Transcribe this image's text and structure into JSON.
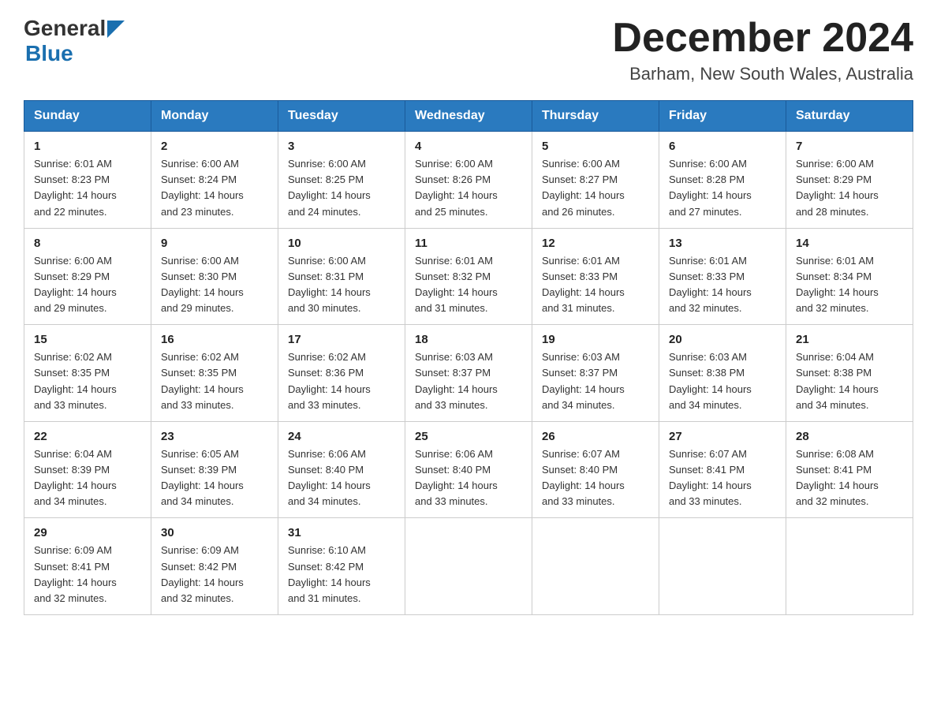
{
  "header": {
    "logo_general": "General",
    "logo_blue": "Blue",
    "month_year": "December 2024",
    "location": "Barham, New South Wales, Australia"
  },
  "weekdays": [
    "Sunday",
    "Monday",
    "Tuesday",
    "Wednesday",
    "Thursday",
    "Friday",
    "Saturday"
  ],
  "weeks": [
    [
      {
        "day": "1",
        "sunrise": "6:01 AM",
        "sunset": "8:23 PM",
        "daylight": "14 hours and 22 minutes."
      },
      {
        "day": "2",
        "sunrise": "6:00 AM",
        "sunset": "8:24 PM",
        "daylight": "14 hours and 23 minutes."
      },
      {
        "day": "3",
        "sunrise": "6:00 AM",
        "sunset": "8:25 PM",
        "daylight": "14 hours and 24 minutes."
      },
      {
        "day": "4",
        "sunrise": "6:00 AM",
        "sunset": "8:26 PM",
        "daylight": "14 hours and 25 minutes."
      },
      {
        "day": "5",
        "sunrise": "6:00 AM",
        "sunset": "8:27 PM",
        "daylight": "14 hours and 26 minutes."
      },
      {
        "day": "6",
        "sunrise": "6:00 AM",
        "sunset": "8:28 PM",
        "daylight": "14 hours and 27 minutes."
      },
      {
        "day": "7",
        "sunrise": "6:00 AM",
        "sunset": "8:29 PM",
        "daylight": "14 hours and 28 minutes."
      }
    ],
    [
      {
        "day": "8",
        "sunrise": "6:00 AM",
        "sunset": "8:29 PM",
        "daylight": "14 hours and 29 minutes."
      },
      {
        "day": "9",
        "sunrise": "6:00 AM",
        "sunset": "8:30 PM",
        "daylight": "14 hours and 29 minutes."
      },
      {
        "day": "10",
        "sunrise": "6:00 AM",
        "sunset": "8:31 PM",
        "daylight": "14 hours and 30 minutes."
      },
      {
        "day": "11",
        "sunrise": "6:01 AM",
        "sunset": "8:32 PM",
        "daylight": "14 hours and 31 minutes."
      },
      {
        "day": "12",
        "sunrise": "6:01 AM",
        "sunset": "8:33 PM",
        "daylight": "14 hours and 31 minutes."
      },
      {
        "day": "13",
        "sunrise": "6:01 AM",
        "sunset": "8:33 PM",
        "daylight": "14 hours and 32 minutes."
      },
      {
        "day": "14",
        "sunrise": "6:01 AM",
        "sunset": "8:34 PM",
        "daylight": "14 hours and 32 minutes."
      }
    ],
    [
      {
        "day": "15",
        "sunrise": "6:02 AM",
        "sunset": "8:35 PM",
        "daylight": "14 hours and 33 minutes."
      },
      {
        "day": "16",
        "sunrise": "6:02 AM",
        "sunset": "8:35 PM",
        "daylight": "14 hours and 33 minutes."
      },
      {
        "day": "17",
        "sunrise": "6:02 AM",
        "sunset": "8:36 PM",
        "daylight": "14 hours and 33 minutes."
      },
      {
        "day": "18",
        "sunrise": "6:03 AM",
        "sunset": "8:37 PM",
        "daylight": "14 hours and 33 minutes."
      },
      {
        "day": "19",
        "sunrise": "6:03 AM",
        "sunset": "8:37 PM",
        "daylight": "14 hours and 34 minutes."
      },
      {
        "day": "20",
        "sunrise": "6:03 AM",
        "sunset": "8:38 PM",
        "daylight": "14 hours and 34 minutes."
      },
      {
        "day": "21",
        "sunrise": "6:04 AM",
        "sunset": "8:38 PM",
        "daylight": "14 hours and 34 minutes."
      }
    ],
    [
      {
        "day": "22",
        "sunrise": "6:04 AM",
        "sunset": "8:39 PM",
        "daylight": "14 hours and 34 minutes."
      },
      {
        "day": "23",
        "sunrise": "6:05 AM",
        "sunset": "8:39 PM",
        "daylight": "14 hours and 34 minutes."
      },
      {
        "day": "24",
        "sunrise": "6:06 AM",
        "sunset": "8:40 PM",
        "daylight": "14 hours and 34 minutes."
      },
      {
        "day": "25",
        "sunrise": "6:06 AM",
        "sunset": "8:40 PM",
        "daylight": "14 hours and 33 minutes."
      },
      {
        "day": "26",
        "sunrise": "6:07 AM",
        "sunset": "8:40 PM",
        "daylight": "14 hours and 33 minutes."
      },
      {
        "day": "27",
        "sunrise": "6:07 AM",
        "sunset": "8:41 PM",
        "daylight": "14 hours and 33 minutes."
      },
      {
        "day": "28",
        "sunrise": "6:08 AM",
        "sunset": "8:41 PM",
        "daylight": "14 hours and 32 minutes."
      }
    ],
    [
      {
        "day": "29",
        "sunrise": "6:09 AM",
        "sunset": "8:41 PM",
        "daylight": "14 hours and 32 minutes."
      },
      {
        "day": "30",
        "sunrise": "6:09 AM",
        "sunset": "8:42 PM",
        "daylight": "14 hours and 32 minutes."
      },
      {
        "day": "31",
        "sunrise": "6:10 AM",
        "sunset": "8:42 PM",
        "daylight": "14 hours and 31 minutes."
      },
      null,
      null,
      null,
      null
    ]
  ]
}
